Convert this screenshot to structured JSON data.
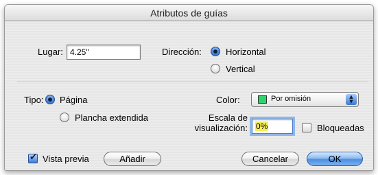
{
  "window": {
    "title": "Atributos de guías"
  },
  "position": {
    "label": "Lugar:",
    "value": "4.25\""
  },
  "direction": {
    "label": "Dirección:",
    "options": [
      {
        "label": "Horizontal",
        "selected": true
      },
      {
        "label": "Vertical",
        "selected": false
      }
    ]
  },
  "type": {
    "label": "Tipo:",
    "options": [
      {
        "label": "Página",
        "selected": true
      },
      {
        "label": "Plancha extendida",
        "selected": false
      }
    ]
  },
  "color": {
    "label": "Color:",
    "selected": "Por omisión",
    "swatch": "#2fd36b"
  },
  "scale": {
    "label_line1": "Escala de",
    "label_line2": "visualización:",
    "value": "0%"
  },
  "locked": {
    "label": "Bloqueadas",
    "checked": false
  },
  "preview": {
    "label": "Vista previa",
    "checked": true
  },
  "buttons": {
    "add": "Añadir",
    "cancel": "Cancelar",
    "ok": "OK"
  },
  "colors": {
    "accent": "#4c8ee0",
    "selection_highlight": "#f5ee5c"
  },
  "icons": {
    "popup_arrows": "up-down-arrows-icon",
    "checkmark": "checkmark-icon"
  }
}
